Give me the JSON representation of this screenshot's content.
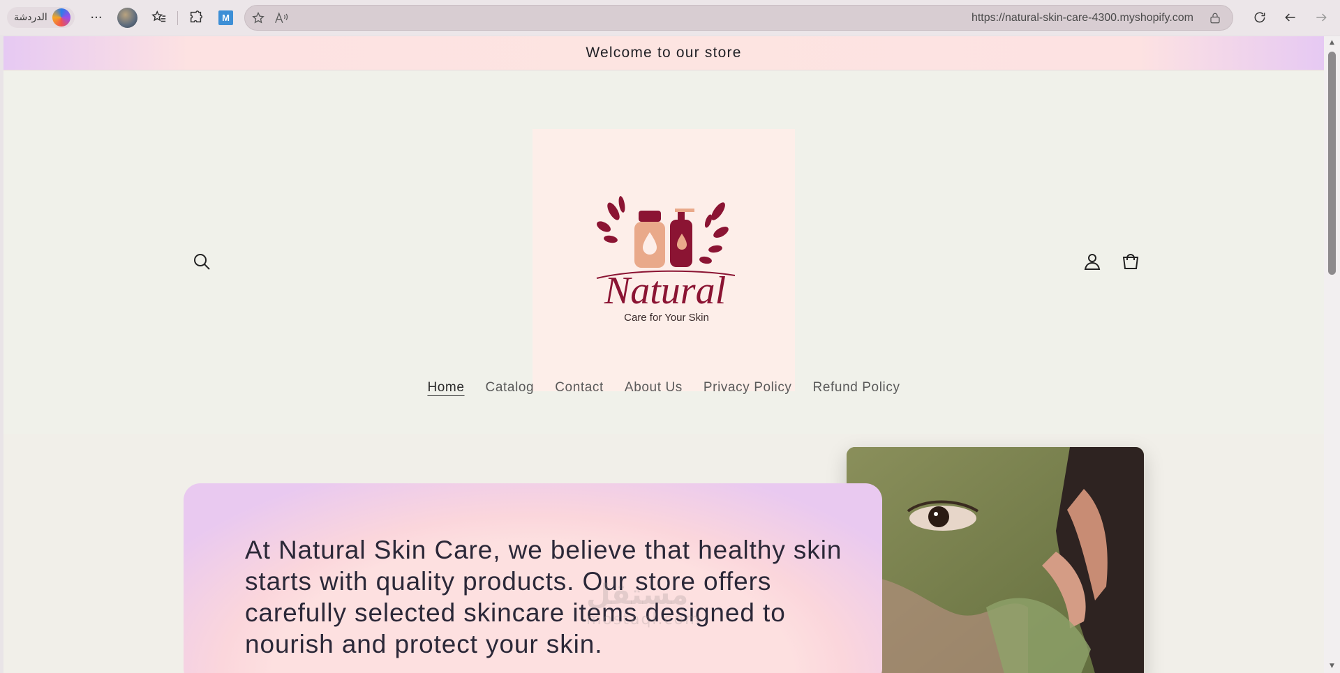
{
  "browser": {
    "copilot_label": "الدردشة",
    "more_label": "···",
    "url": "https://natural-skin-care-4300.myshopify.com",
    "icons": [
      "copilot-icon",
      "more-icon",
      "profile-avatar",
      "favorites-icon",
      "extensions-icon",
      "m-extension-icon",
      "star-icon",
      "read-aloud-icon",
      "lock-icon",
      "refresh-icon",
      "back-icon",
      "forward-icon"
    ]
  },
  "store": {
    "announcement": "Welcome to our store",
    "logo": {
      "title": "Natural",
      "tagline": "Care for Your Skin"
    },
    "nav": [
      {
        "label": "Home",
        "active": true
      },
      {
        "label": "Catalog",
        "active": false
      },
      {
        "label": "Contact",
        "active": false
      },
      {
        "label": "About Us",
        "active": false
      },
      {
        "label": "Privacy Policy",
        "active": false
      },
      {
        "label": "Refund Policy",
        "active": false
      }
    ],
    "hero": {
      "text": "At Natural Skin Care, we believe that healthy skin starts with quality products. Our store offers carefully selected skincare items designed to nourish and protect your skin."
    },
    "watermark": {
      "arabic": "مستقل",
      "latin": "mostaql.com"
    }
  },
  "colors": {
    "accent": "#8b1433",
    "logo_peach": "#e9a98a",
    "page_bg": "#f1efe9",
    "logo_bg": "#fdeee9"
  }
}
